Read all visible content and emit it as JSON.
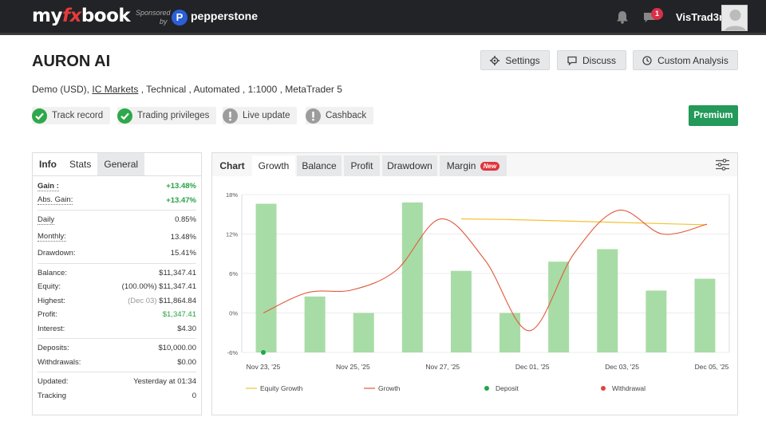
{
  "topbar": {
    "logo_pre": "my",
    "logo_fx": "fx",
    "logo_post": "book",
    "sponsored": "Sponsored",
    "by": "by",
    "pp_mark": "P",
    "sponsor": "pepperstone",
    "chat_badge": "1",
    "username": "VisTrad3r"
  },
  "header": {
    "title": "AURON AI",
    "buttons": {
      "settings": "Settings",
      "discuss": "Discuss",
      "custom": "Custom Analysis"
    },
    "sub_pre": "Demo (USD),",
    "broker": "IC Markets",
    "sub_post": ", Technical , Automated , 1:1000 , MetaTrader 5",
    "badges": [
      "Track record",
      "Trading privileges",
      "Live update",
      "Cashback"
    ],
    "premium": "Premium"
  },
  "info": {
    "tabs": [
      "Info",
      "Stats",
      "General"
    ],
    "gain_label": "Gain :",
    "gain": "+13.48%",
    "absgain_label": "Abs. Gain:",
    "absgain": "+13.47%",
    "daily_label": "Daily",
    "daily": "0.85%",
    "monthly_label": "Monthly:",
    "monthly": "13.48%",
    "drawdown_label": "Drawdown:",
    "drawdown": "15.41%",
    "balance_label": "Balance:",
    "balance": "$11,347.41",
    "equity_label": "Equity:",
    "equity_pct": "(100.00%)",
    "equity": "$11,347.41",
    "highest_label": "Highest:",
    "highest_date": "(Dec 03)",
    "highest": "$11,864.84",
    "profit_label": "Profit:",
    "profit": "$1,347.41",
    "interest_label": "Interest:",
    "interest": "$4.30",
    "deposits_label": "Deposits:",
    "deposits": "$10,000.00",
    "withdrawals_label": "Withdrawals:",
    "withdrawals": "$0.00",
    "updated_label": "Updated:",
    "updated": "Yesterday at 01:34",
    "tracking_label": "Tracking",
    "tracking": "0"
  },
  "chart_tabs": {
    "chart": "Chart",
    "growth": "Growth",
    "balance": "Balance",
    "profit": "Profit",
    "drawdown": "Drawdown",
    "margin": "Margin",
    "new": "New"
  },
  "chart_data": {
    "type": "bar",
    "y_ticks": [
      "18%",
      "12%",
      "6%",
      "0%",
      "-6%"
    ],
    "x_labels": [
      "Nov 23, '25",
      "Nov 25, '25",
      "Nov 27, '25",
      "Dec 01, '25",
      "Dec 03, '25",
      "Dec 05, '25"
    ],
    "ylim": [
      -6,
      18
    ],
    "bars": [
      16.6,
      2.5,
      -0.3,
      16.8,
      6.4,
      -0.3,
      7.8,
      9.7,
      3.4,
      5.2
    ],
    "equity_growth": [
      14.3,
      14.2,
      14.0,
      13.8,
      13.6,
      13.4
    ],
    "growth": [
      0,
      3.1,
      3.5,
      6.5,
      14.3,
      8,
      -2.7,
      9,
      15.6,
      12,
      13.5
    ],
    "deposit": -6,
    "legend": [
      "Equity Growth",
      "Growth",
      "Deposit",
      "Withdrawal"
    ],
    "colors": {
      "bar": "#a8dca6",
      "equity": "#f2c230",
      "growth": "#e3583c",
      "deposit": "#1ea64b",
      "withdrawal": "#e0443b"
    }
  }
}
